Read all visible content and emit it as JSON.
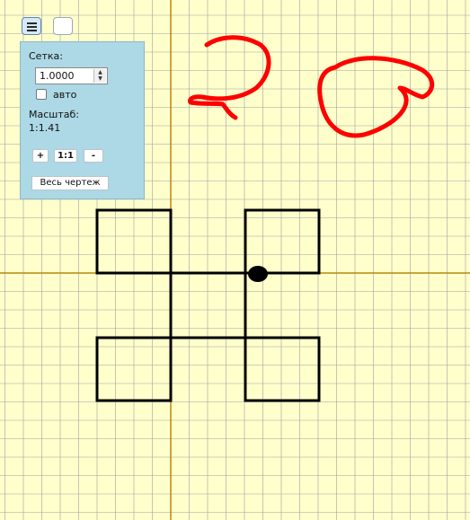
{
  "toolbar": {
    "menu_icon": "hamburger-icon"
  },
  "panel": {
    "grid_label": "Сетка:",
    "grid_value": "1.0000",
    "auto_label": "авто",
    "auto_checked": false,
    "scale_label": "Масштаб:",
    "scale_value": "1:1.41",
    "zoom_in_label": "+",
    "reset_label": "1:1",
    "zoom_out_label": "-",
    "fit_label": "Весь чертеж"
  },
  "canvas": {
    "background": "#FFFFCC",
    "grid_color": "#A0A0A0",
    "axis_color": "#B8860B",
    "shape_color": "#000000",
    "scribble_color": "#FF0000"
  }
}
